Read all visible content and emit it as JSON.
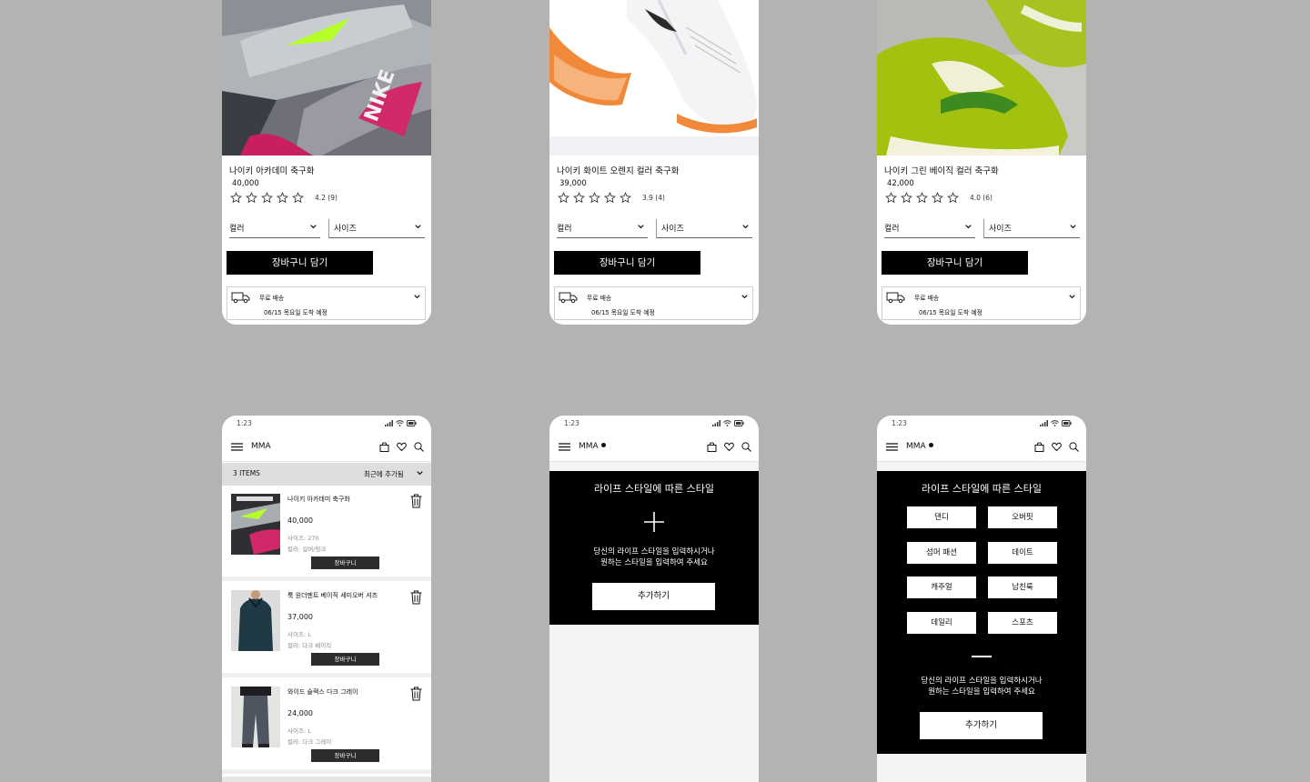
{
  "products": [
    {
      "name": "나이키 아카데미 축구화",
      "price": "40,000",
      "rating": "4.2 (9)",
      "stars_filled": 0,
      "color_label": "컬러",
      "size_label": "사이즈",
      "add_to_cart": "장바구니 담기",
      "shipping": "무료 배송",
      "arrival": "06/15 목요일 도착 예정"
    },
    {
      "name": "나이키 화이트 오렌지 컬러 축구화",
      "price": "39,000",
      "rating": "3.9 (4)",
      "stars_filled": 0,
      "color_label": "컬러",
      "size_label": "사이즈",
      "add_to_cart": "장바구니 담기",
      "shipping": "무료 배송",
      "arrival": "06/15 목요일 도착 예정"
    },
    {
      "name": "나이키 그린 베이직 컬러 축구화",
      "price": "42,000",
      "rating": "4.0 (6)",
      "stars_filled": 0,
      "color_label": "컬러",
      "size_label": "사이즈",
      "add_to_cart": "장바구니 담기",
      "shipping": "무료 배송",
      "arrival": "06/15 목요일 도착 예정"
    }
  ],
  "status_time": "1:23",
  "brand": "MMA",
  "icons": [
    "menu-icon",
    "shopping-bag-icon",
    "heart-icon",
    "search-icon",
    "signal-icon",
    "wifi-icon",
    "battery-icon",
    "trash-icon",
    "truck-icon",
    "chevron-down-icon",
    "plus-icon",
    "star-icon"
  ],
  "cart": {
    "count": "3 ITEMS",
    "sort": "최근에 추가됨",
    "items": [
      {
        "name": "나이키 아카데미 축구화",
        "price": "40,000",
        "size": "사이즈: 270",
        "color": "컬러: 실버/핑크",
        "button": "장바구니"
      },
      {
        "name": "룩 원더멘트 베이직 세미오버 셔츠",
        "price": "37,000",
        "size": "사이즈: L",
        "color": "컬러: 다크 베이직",
        "button": "장바구니"
      },
      {
        "name": "와이드 슬랙스 다크 그레이",
        "price": "24,000",
        "size": "사이즈: L",
        "color": "컬러: 다크 그레이",
        "button": "장바구니"
      }
    ]
  },
  "style_empty": {
    "title": "라이프 스타일에 따른 스타일",
    "desc_line1": "당신의 라이프 스타일을 입력하시거나",
    "desc_line2": "원하는 스타일을 입력하여 주세요",
    "add_button": "추가하기"
  },
  "style_filled": {
    "title": "라이프 스타일에 따른 스타일",
    "chips": [
      "댄디",
      "오버핏",
      "섬머 패션",
      "데이트",
      "캐주얼",
      "남친룩",
      "데일리",
      "스포츠"
    ],
    "desc_line1": "당신의 라이프 스타일을 입력하시거나",
    "desc_line2": "원하는 스타일을 입력하여 주세요",
    "add_button": "추가하기"
  },
  "colors": {
    "background": "#b3b3b3",
    "primary": "#000000",
    "surface": "#ffffff",
    "cart_header": "#dedede"
  }
}
